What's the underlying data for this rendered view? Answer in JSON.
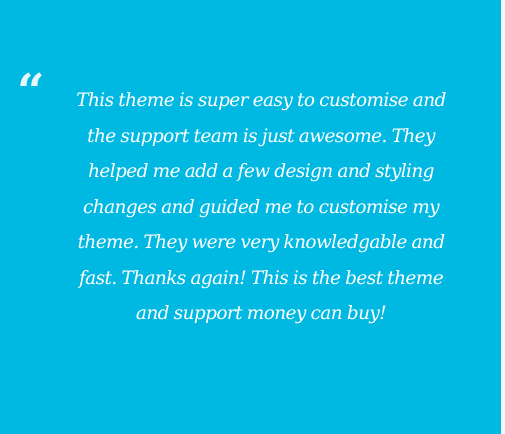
{
  "testimonial": {
    "quote_icon": "opening-double-quote-icon",
    "quote_glyph": "“",
    "text": "This theme is super easy to customise and the support team is just awesome. They helped me add a few design and styling changes and guided me to customise my theme. They were very knowledgable and fast. Thanks again! This is the best theme and support money can buy!"
  },
  "colors": {
    "background": "#00b9e2",
    "text": "#ffffff",
    "quote_icon": "#e8f7fc",
    "right_edge": "#f2f7f9"
  }
}
